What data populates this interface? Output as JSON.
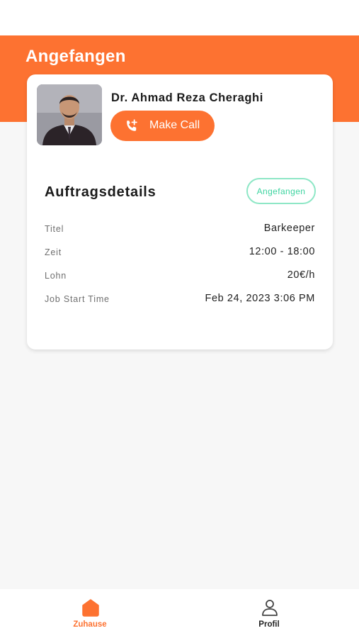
{
  "header": {
    "title": "Angefangen"
  },
  "contact": {
    "name": "Dr. Ahmad Reza Cheraghi",
    "call_label": "Make Call"
  },
  "details": {
    "title": "Auftragsdetails",
    "status": "Angefangen",
    "rows": [
      {
        "label": "Titel",
        "value": "Barkeeper"
      },
      {
        "label": "Zeit",
        "value": "12:00 - 18:00"
      },
      {
        "label": "Lohn",
        "value": "20€/h"
      },
      {
        "label": "Job Start Time",
        "value": "Feb 24, 2023 3:06 PM"
      }
    ]
  },
  "nav": {
    "items": [
      {
        "label": "Zuhause",
        "icon": "home-icon",
        "active": true
      },
      {
        "label": "Profil",
        "icon": "profile-icon",
        "active": false
      }
    ]
  },
  "colors": {
    "accent": "#fd7231",
    "status_green": "#3dd4a0",
    "nav_inactive": "#222222"
  }
}
